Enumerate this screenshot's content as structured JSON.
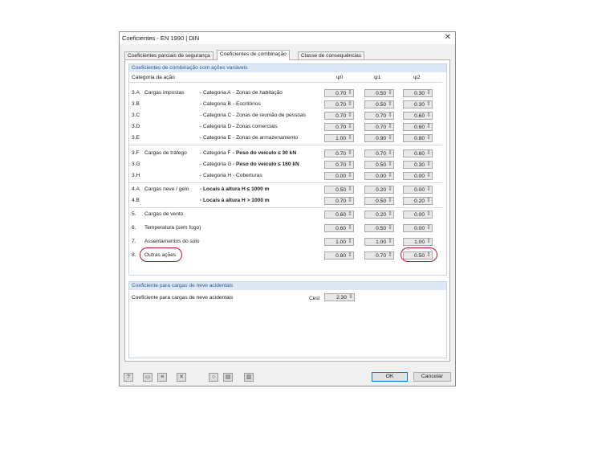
{
  "window": {
    "title": "Coeficientes - EN 1990 | DIN",
    "close": "✕"
  },
  "tabs": [
    {
      "label": "Coeficientes parciais de segurança"
    },
    {
      "label": "Coeficientes de combinação"
    },
    {
      "label": "Classe de consequências"
    }
  ],
  "combo": {
    "title": "Coeficientes de combinação com ações variáveis",
    "headers": {
      "category": "Categoria da ação",
      "psi0": "ψ0",
      "psi1": "ψ1",
      "psi2": "ψ2"
    },
    "rows": [
      {
        "code": "3.A",
        "name": "Cargas impostas",
        "cat": "- Categoria A",
        "desc": "- Zonas de habitação",
        "bold": false,
        "psi0": "0.70",
        "psi1": "0.50",
        "psi2": "0.30"
      },
      {
        "code": "3.B",
        "name": "",
        "cat": "- Categoria B",
        "desc": "- Escritórios",
        "bold": false,
        "psi0": "0.70",
        "psi1": "0.50",
        "psi2": "0.30"
      },
      {
        "code": "3.C",
        "name": "",
        "cat": "- Categoria C",
        "desc": "- Zonas de reunião de pessoas",
        "bold": false,
        "psi0": "0.70",
        "psi1": "0.70",
        "psi2": "0.60"
      },
      {
        "code": "3.D",
        "name": "",
        "cat": "- Categoria D",
        "desc": "- Zonas comerciais",
        "bold": false,
        "psi0": "0.70",
        "psi1": "0.70",
        "psi2": "0.60"
      },
      {
        "code": "3.E",
        "name": "",
        "cat": "- Categoria E",
        "desc": "- Zonas de armazenamento",
        "bold": false,
        "psi0": "1.00",
        "psi1": "0.90",
        "psi2": "0.80"
      },
      {
        "code": "3.F",
        "name": "Cargas de tráfego",
        "cat": "- Categoria F",
        "desc": "- Peso do veículo ≤ 30 kN",
        "bold": true,
        "psi0": "0.70",
        "psi1": "0.70",
        "psi2": "0.60"
      },
      {
        "code": "3.G",
        "name": "",
        "cat": "- Categoria G",
        "desc": "- Peso do veículo ≤ 160 kN",
        "bold": true,
        "psi0": "0.70",
        "psi1": "0.50",
        "psi2": "0.30"
      },
      {
        "code": "3.H",
        "name": "",
        "cat": "- Categoria H",
        "desc": "- Coberturas",
        "bold": false,
        "psi0": "0.00",
        "psi1": "0.00",
        "psi2": "0.00"
      },
      {
        "code": "4.A",
        "name": "Cargas neve / gelo",
        "cat": "- Locais à altura H ≤ 1000 m",
        "desc": "",
        "bold": true,
        "psi0": "0.50",
        "psi1": "0.20",
        "psi2": "0.00"
      },
      {
        "code": "4.B",
        "name": "",
        "cat": "- Locais à altura H > 1000 m",
        "desc": "",
        "bold": true,
        "psi0": "0.70",
        "psi1": "0.50",
        "psi2": "0.20"
      },
      {
        "code": "5.",
        "name": "Cargas de vento",
        "cat": "",
        "desc": "",
        "bold": false,
        "psi0": "0.60",
        "psi1": "0.20",
        "psi2": "0.00"
      },
      {
        "code": "6.",
        "name": "Temperatura (sem fogo)",
        "cat": "",
        "desc": "",
        "bold": false,
        "psi0": "0.60",
        "psi1": "0.50",
        "psi2": "0.00"
      },
      {
        "code": "7.",
        "name": "Assentamentos do solo",
        "cat": "",
        "desc": "",
        "bold": false,
        "psi0": "1.00",
        "psi1": "1.00",
        "psi2": "1.00"
      },
      {
        "code": "8.",
        "name": "Outras ações",
        "cat": "",
        "desc": "",
        "bold": false,
        "psi0": "0.80",
        "psi1": "0.70",
        "psi2": "0.50"
      }
    ]
  },
  "snow": {
    "title": "Coeficiente para cargas de neve acidentais",
    "label": "Coeficiente para cargas de neve acidentais",
    "symbol": "Cesl",
    "value": "2.30"
  },
  "footer": {
    "ok": "OK",
    "cancel": "Cancelar"
  },
  "spin_arrow": "⇕",
  "colors": {
    "highlight_ring": "#c8102e",
    "group_header": "#dde8f5"
  }
}
